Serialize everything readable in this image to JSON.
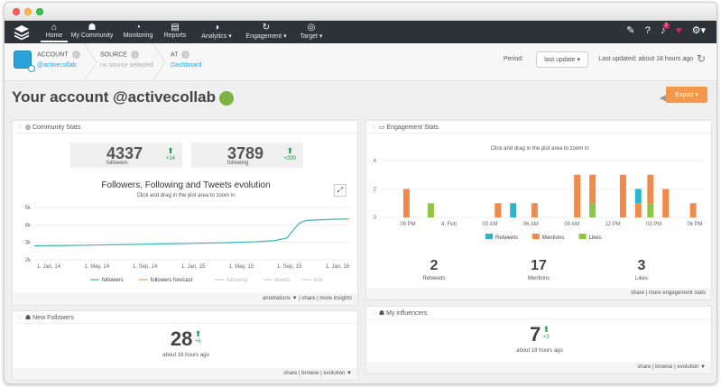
{
  "nav": {
    "items": [
      {
        "label": "Home",
        "icon": "home-icon"
      },
      {
        "label": "My Community",
        "icon": "community-icon"
      },
      {
        "label": "Monitoring",
        "icon": "monitoring-icon"
      },
      {
        "label": "Reports",
        "icon": "reports-icon"
      },
      {
        "label": "Analytics ▾",
        "icon": "analytics-icon"
      },
      {
        "label": "Engagement ▾",
        "icon": "engagement-icon"
      },
      {
        "label": "Target ▾",
        "icon": "target-icon"
      }
    ],
    "notification_count": "1"
  },
  "crumbs": {
    "account_label": "ACCOUNT",
    "account_value": "@activecollab",
    "source_label": "SOURCE",
    "source_value": "no source selected",
    "at_label": "AT",
    "at_value": "Dashboard"
  },
  "period": {
    "label": "Period:",
    "value": "last update"
  },
  "last_updated": "Last updated: about 18 hours ago",
  "page_title": "Your account @activecollab",
  "export_label": "Export",
  "community": {
    "title": "Community Stats",
    "followers": {
      "value": "4337",
      "label": "followers",
      "delta": "+14"
    },
    "following": {
      "value": "3789",
      "label": "following",
      "delta": "+390"
    },
    "chart_title": "Followers, Following and Tweets evolution",
    "chart_sub": "Click and drag in the plot area to zoom in",
    "footer": "annotations ▼   |  share   |  more insights"
  },
  "engagement": {
    "title": "Engagement Stats",
    "chart_sub": "Click and drag in the plot area to zoom in",
    "retweets": {
      "value": "2",
      "label": "Retweets"
    },
    "mentions": {
      "value": "17",
      "label": "Mentions"
    },
    "likes": {
      "value": "3",
      "label": "Likes"
    },
    "footer": "share   |  more engagement stats"
  },
  "new_followers": {
    "title": "New Followers",
    "value": "28",
    "delta": "+6",
    "time": "about 18 hours ago",
    "footer": "share   |  browse   | evolution ▼"
  },
  "influencers": {
    "title": "My influencers",
    "value": "7",
    "delta": "+3",
    "time": "about 18 hours ago",
    "footer": "share   |  browse   | evolution ▼"
  },
  "chart_data": [
    {
      "type": "line",
      "title": "Followers, Following and Tweets evolution",
      "x_ticks": [
        "1. Jan, 14",
        "1. May, 14",
        "1. Sep, 14",
        "1. Jan, 15",
        "1. May, 15",
        "1. Sep, 15",
        "1. Jan, 16"
      ],
      "y_ticks": [
        "2k",
        "3k",
        "4k",
        "5k"
      ],
      "ylim": [
        2000,
        5000
      ],
      "legend": [
        "followers",
        "followers forecast",
        "following",
        "tweets",
        "lists"
      ],
      "series": [
        {
          "name": "followers",
          "color": "#3bb3b6",
          "x": [
            0,
            0.1,
            0.2,
            0.3,
            0.4,
            0.5,
            0.6,
            0.7,
            0.76,
            0.8,
            0.82,
            0.84,
            0.86,
            0.9,
            0.95,
            0.99
          ],
          "y": [
            2800,
            2820,
            2850,
            2880,
            2910,
            2940,
            2980,
            3030,
            3100,
            3250,
            3700,
            4100,
            4250,
            4290,
            4320,
            4337
          ]
        },
        {
          "name": "followers forecast",
          "color": "#f29848",
          "x": [
            0.99,
            1.0
          ],
          "y": [
            4337,
            4350
          ]
        }
      ]
    },
    {
      "type": "bar",
      "stacked": true,
      "x_ticks": [
        "09 PM",
        "4. Feb",
        "03 AM",
        "06 AM",
        "09 AM",
        "12 PM",
        "03 PM",
        "06 PM"
      ],
      "y_ticks": [
        "0",
        "2",
        "4"
      ],
      "ylim": [
        0,
        4
      ],
      "legend": [
        "Retweets",
        "Mentions",
        "Likes"
      ],
      "colors": {
        "Retweets": "#2bb6c9",
        "Mentions": "#f0894a",
        "Likes": "#8dc63f"
      },
      "bars": [
        {
          "x": 0.05,
          "Retweets": 0,
          "Mentions": 2,
          "Likes": 0
        },
        {
          "x": 0.13,
          "Retweets": 0,
          "Mentions": 0,
          "Likes": 1
        },
        {
          "x": 0.35,
          "Retweets": 0,
          "Mentions": 1,
          "Likes": 0
        },
        {
          "x": 0.4,
          "Retweets": 1,
          "Mentions": 0,
          "Likes": 0
        },
        {
          "x": 0.47,
          "Retweets": 0,
          "Mentions": 1,
          "Likes": 0
        },
        {
          "x": 0.61,
          "Retweets": 0,
          "Mentions": 3,
          "Likes": 0
        },
        {
          "x": 0.66,
          "Retweets": 0,
          "Mentions": 2,
          "Likes": 1
        },
        {
          "x": 0.76,
          "Retweets": 0,
          "Mentions": 3,
          "Likes": 0
        },
        {
          "x": 0.81,
          "Retweets": 1,
          "Mentions": 1,
          "Likes": 0
        },
        {
          "x": 0.85,
          "Retweets": 0,
          "Mentions": 2,
          "Likes": 1
        },
        {
          "x": 0.9,
          "Retweets": 0,
          "Mentions": 2,
          "Likes": 0
        },
        {
          "x": 0.99,
          "Retweets": 0,
          "Mentions": 1,
          "Likes": 0
        }
      ]
    }
  ]
}
